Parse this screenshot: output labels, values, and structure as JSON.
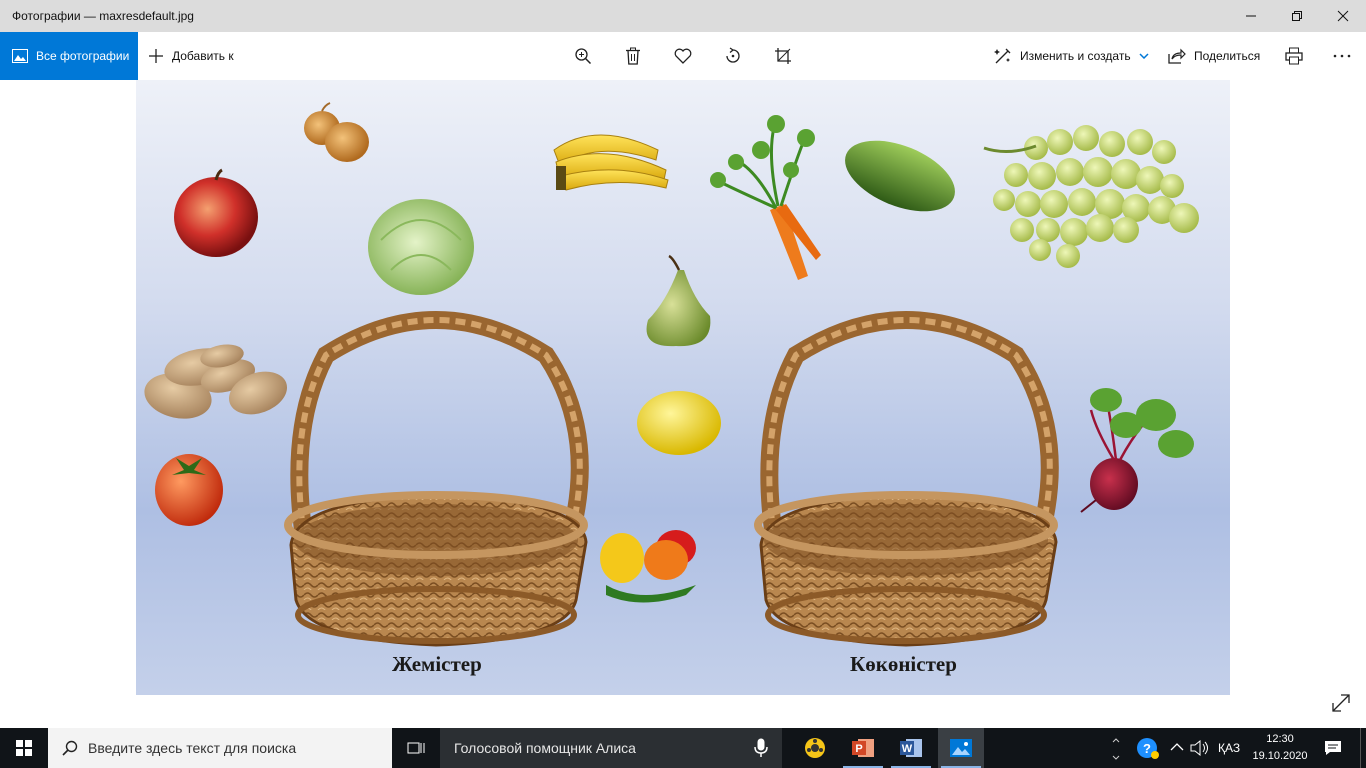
{
  "window": {
    "title": "Фотографии — maxresdefault.jpg"
  },
  "toolbar": {
    "all_photos_label": "Все фотографии",
    "add_to_label": "Добавить к",
    "edit_create_label": "Изменить и создать",
    "share_label": "Поделиться",
    "icons": [
      "zoom-in-icon",
      "delete-icon",
      "favorite-icon",
      "rotate-icon",
      "crop-icon",
      "print-icon",
      "more-icon"
    ]
  },
  "photo": {
    "basket_left_label": "Жемістер",
    "basket_right_label": "Көкөністер",
    "items": [
      "onion",
      "apple",
      "cabbage",
      "banana",
      "carrot",
      "cucumber",
      "grapes",
      "pear",
      "potato",
      "lemon",
      "tomato",
      "bell-peppers",
      "beetroot"
    ]
  },
  "taskbar": {
    "search_placeholder": "Введите здесь текст для поиска",
    "assistant_label": "Голосовой помощник Алиса",
    "language": "ҚАЗ",
    "time": "12:30",
    "date": "19.10.2020"
  },
  "colors": {
    "accent": "#0078d7",
    "titlebar": "#dcdcdc",
    "taskbar": "#101418"
  }
}
